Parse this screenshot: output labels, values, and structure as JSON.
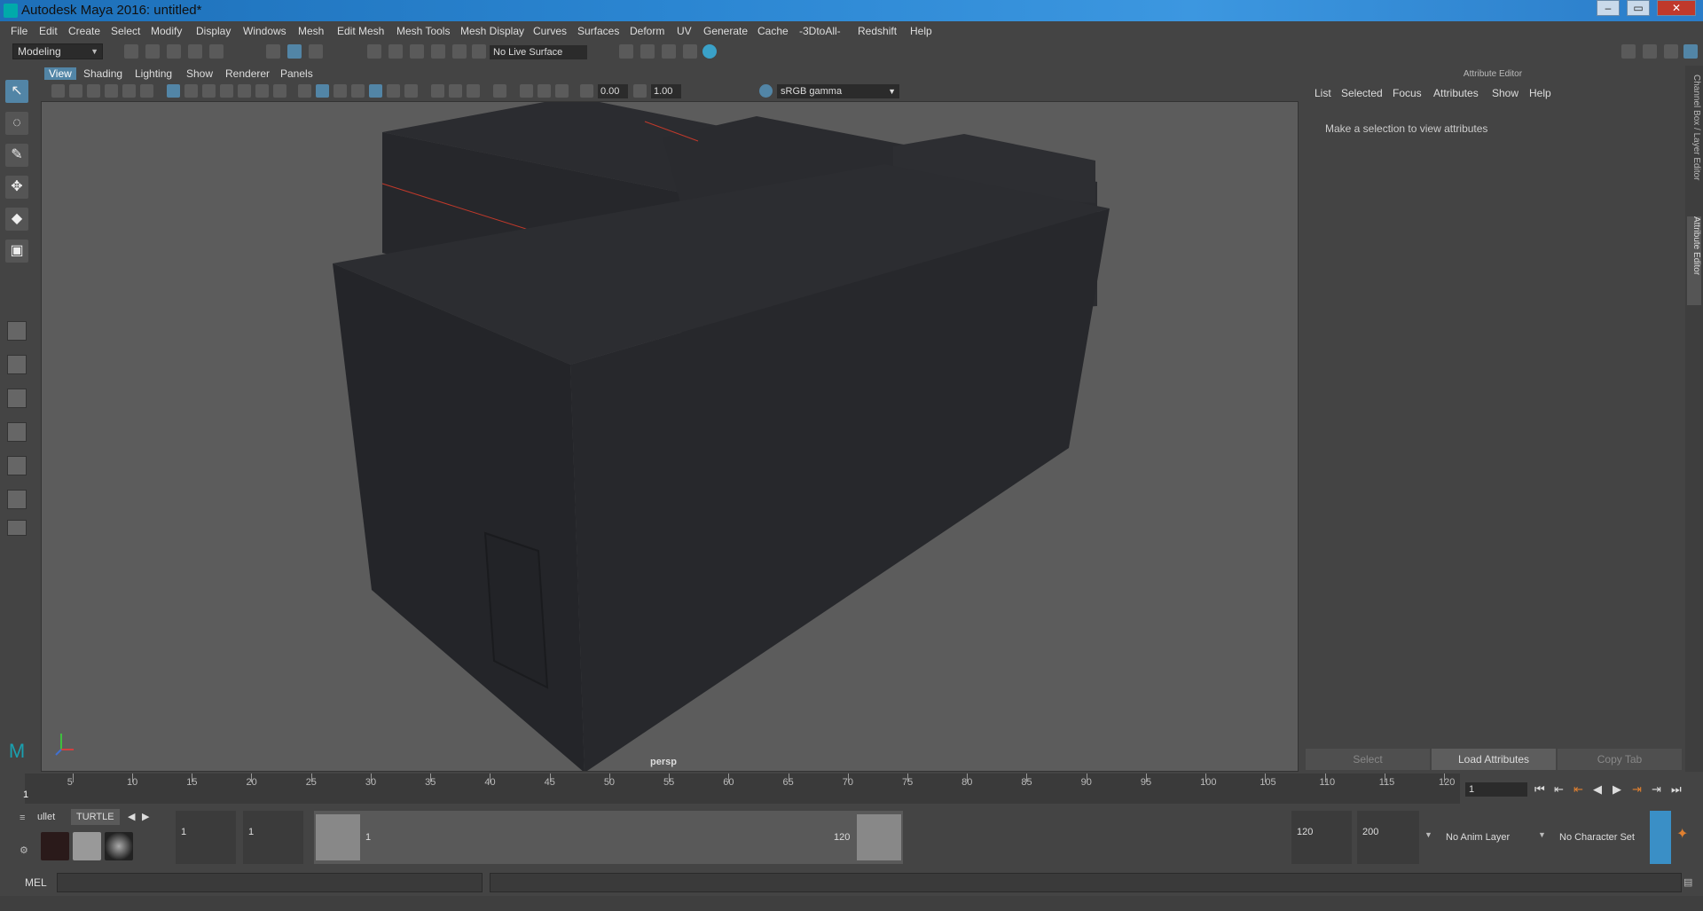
{
  "window": {
    "title": "Autodesk Maya 2016: untitled*"
  },
  "menubar": [
    "File",
    "Edit",
    "Create",
    "Select",
    "Modify",
    "Display",
    "Windows",
    "Mesh",
    "Edit Mesh",
    "Mesh Tools",
    "Mesh Display",
    "Curves",
    "Surfaces",
    "Deform",
    "UV",
    "Generate",
    "Cache",
    "-3DtoAll-",
    "Redshift",
    "Help"
  ],
  "statusline": {
    "mode": "Modeling",
    "live_surface": "No Live Surface"
  },
  "viewport": {
    "menu": [
      "View",
      "Shading",
      "Lighting",
      "Show",
      "Renderer",
      "Panels"
    ],
    "exposure": "0.00",
    "gamma_value": "1.00",
    "color_space": "sRGB gamma",
    "camera": "persp"
  },
  "attribute_editor": {
    "title": "Attribute Editor",
    "menu": [
      "List",
      "Selected",
      "Focus",
      "Attributes",
      "Show",
      "Help"
    ],
    "message": "Make a selection to view attributes",
    "buttons": {
      "select": "Select",
      "load": "Load Attributes",
      "copy": "Copy Tab"
    },
    "side_tabs": [
      "Channel Box / Layer Editor",
      "Attribute Editor"
    ]
  },
  "timeline": {
    "ticks": [
      "5",
      "10",
      "15",
      "20",
      "25",
      "30",
      "35",
      "40",
      "45",
      "50",
      "55",
      "60",
      "65",
      "70",
      "75",
      "80",
      "85",
      "90",
      "95",
      "100",
      "105",
      "110",
      "115",
      "120"
    ],
    "start_label": "1",
    "current_frame": "1"
  },
  "range": {
    "shelf_tabs": [
      "ullet",
      "TURTLE"
    ],
    "start": "1",
    "playback_start": "1",
    "range_start": "1",
    "range_end": "120",
    "playback_end": "120",
    "end": "200",
    "anim_layer": "No Anim Layer",
    "character_set": "No Character Set"
  },
  "cmdline": {
    "label": "MEL"
  }
}
